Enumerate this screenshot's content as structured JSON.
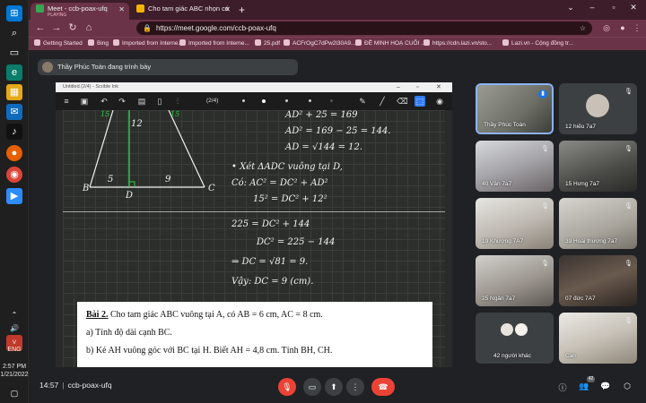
{
  "browser": {
    "tabs": [
      {
        "title": "Meet - ccb-poax-ufq",
        "subtitle": "PLAYING"
      },
      {
        "title": "Cho tam giác ABC nhọn có AB"
      }
    ],
    "url": "https://meet.google.com/ccb-poax-ufq",
    "bookmarks": [
      "Getting Started",
      "Bing",
      "Imported from Interne...",
      "Imported from Interne...",
      "25.pdf",
      "ACFrOgC7dPw2l30A9...",
      "ĐỀ MINH HOẠ CUỐI ...",
      "https://cdn.lazi.vn/sto...",
      "Lazi.vn - Cộng đồng tr..."
    ]
  },
  "taskbar": {
    "lang": "ENG",
    "time": "2:57 PM",
    "date": "1/21/2022"
  },
  "meet": {
    "presenter_banner": "Thầy Phúc Toàn đang trình bày",
    "shared_window_title": "Untitled (2/4) - Scrible Ink",
    "page_indicator": "(2/4)",
    "board": {
      "labels": [
        "B",
        "D",
        "C",
        "5",
        "9",
        "12",
        "15",
        "15"
      ],
      "lines": [
        "AD² + 25 = 169",
        "AD² = 169 − 25 = 144.",
        "AD = √144 = 12.",
        "• Xét ΔADC vuông tại D,",
        "Có: AC² = DC² + AD²",
        "15² = DC² + 12²",
        "225 = DC² + 144",
        "DC² = 225 − 144",
        "⇒ DC = √81 = 9.",
        "Vậy: DC = 9 (cm)."
      ]
    },
    "problem": {
      "label": "Bài 2.",
      "line1": "Cho tam giác ABC vuông tại A, có AB = 6 cm, AC = 8 cm.",
      "line2": "a) Tính độ dài cạnh BC.",
      "line3": "b) Kẻ AH vuông góc với BC tại H. Biết AH = 4,8 cm. Tính BH, CH."
    },
    "participants": [
      "Thầy Phúc Toàn",
      "12 hiếu 7a7",
      "40 Vân 7a7",
      "15 Hưng 7a7",
      "19 Khương 7A7",
      "39 Hoài thương 7a7",
      "25 Ngân 7a7",
      "07 đức 7A7",
      "42 người khác",
      "Can"
    ],
    "meeting_time": "14:57",
    "meeting_code": "ccb-poax-ufq",
    "participant_count": "42"
  },
  "colors": {
    "end_call": "#ea4335",
    "active_speaker": "#8ab4f8",
    "browser_frame": "#6b3347"
  }
}
